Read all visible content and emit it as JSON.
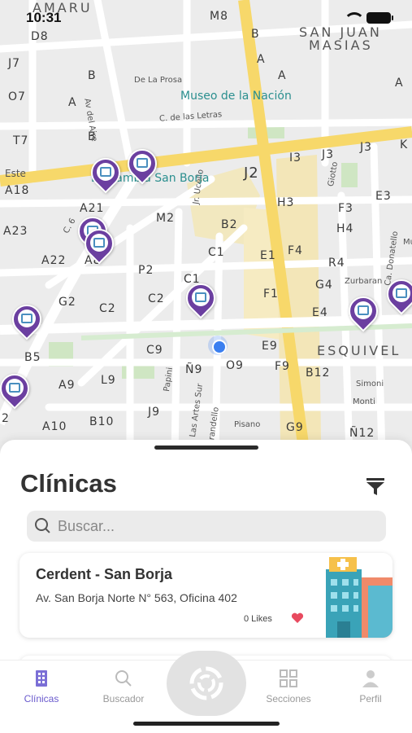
{
  "status_bar": {
    "time": "10:31"
  },
  "map": {
    "districts": [
      "AMARU",
      "SAN JUAN",
      "MASIAS",
      "ESQUIVEL"
    ],
    "blocks": [
      "D8",
      "M8",
      "B",
      "A",
      "A",
      "A",
      "J7",
      "O7",
      "A",
      "B",
      "T7",
      "B",
      "A18",
      "J2",
      "I3",
      "J3",
      "J3",
      "K",
      "H3",
      "E3",
      "A21",
      "M2",
      "B2",
      "A23",
      "F3",
      "H4",
      "A22",
      "A8",
      "P2",
      "C1",
      "E1",
      "F4",
      "R4",
      "C1",
      "G2",
      "C2",
      "C2",
      "F1",
      "G4",
      "E4",
      "B5",
      "C9",
      "E9",
      "Ñ9",
      "O9",
      "F9",
      "B12",
      "A9",
      "L9",
      "A10",
      "B10",
      "J9",
      "G9",
      "Ñ12",
      "2"
    ],
    "streets": [
      "De La Prosa",
      "Av del Aire",
      "C. de las Letras",
      "Este",
      "Jr. Ucello",
      "C. 6",
      "Zurbaran",
      "Ca. Donatello",
      "Giotto",
      "Papini",
      "Simoni",
      "Monti",
      "Pisano",
      "Las Artes Sur",
      "Pirandello",
      "Mu"
    ],
    "poi": [
      "Museo de la Nación",
      "La Rambla San Borja"
    ]
  },
  "sheet": {
    "title": "Clínicas",
    "search_placeholder": "Buscar...",
    "clinics": [
      {
        "name": "Cerdent - San Borja",
        "address": "Av. San Borja Norte N° 563, Oficina 402",
        "likes": "0 Likes"
      }
    ]
  },
  "tabs": [
    {
      "label": "Clínicas",
      "icon": "building-icon",
      "active": true
    },
    {
      "label": "Buscador",
      "icon": "search-icon"
    },
    {
      "label": "",
      "icon": "radar-icon"
    },
    {
      "label": "Secciones",
      "icon": "grid-icon"
    },
    {
      "label": "Perfil",
      "icon": "person-icon"
    }
  ],
  "colors": {
    "accent": "#6a5acd",
    "marker": "#6b3fa0",
    "heart": "#e84a5f"
  }
}
